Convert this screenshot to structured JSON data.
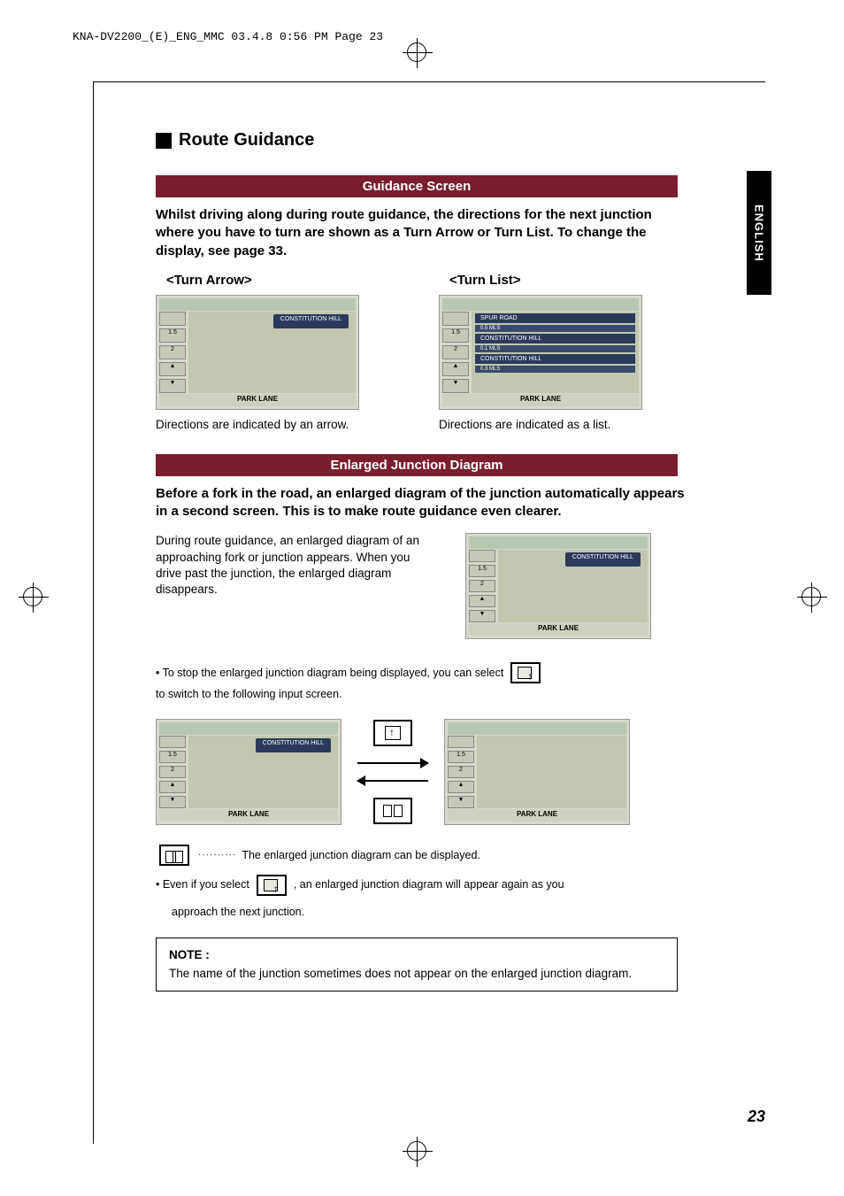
{
  "print_header": "KNA-DV2200_(E)_ENG_MMC  03.4.8  0:56 PM  Page 23",
  "side_tab": "ENGLISH",
  "section_title": "Route Guidance",
  "banner1": "Guidance Screen",
  "lead1": "Whilst driving along during route guidance, the directions for the next junction where you have to turn are shown as a Turn Arrow or Turn List. To change the display, see page 33.",
  "col1_title": "<Turn Arrow>",
  "col1_caption": "Directions are indicated by an arrow.",
  "col2_title": "<Turn List>",
  "col2_caption": "Directions are indicated as a list.",
  "banner2": "Enlarged Junction Diagram",
  "lead2": "Before a fork in the road, an enlarged diagram of the junction automatically appears in a second screen. This is to make route guidance even clearer.",
  "body2": "During route guidance, an enlarged diagram of an approaching fork or junction appears. When you drive past the junction, the enlarged diagram disappears.",
  "bullet1_a": "• To stop the enlarged junction diagram being displayed, you can select",
  "bullet1_b": "to switch to the following input screen.",
  "dotted_text": "The enlarged junction diagram can be displayed.",
  "bullet2_a": "• Even if you select",
  "bullet2_b": ", an enlarged junction diagram will appear again as you",
  "bullet2_c": "approach the next junction.",
  "note_title": "NOTE :",
  "note_body": "The name of the junction sometimes does not appear on the enlarged junction diagram.",
  "page_number": "23",
  "ss": {
    "constitution": "CONSTITUTION HILL",
    "parklane": "PARK LANE",
    "spur": "SPUR ROAD",
    "d05": "0.5 MLS",
    "d01": "0.1 MLS",
    "d03": "0.3 MLS",
    "mls": "MLS",
    "n15": "1.5",
    "n2": "2"
  }
}
